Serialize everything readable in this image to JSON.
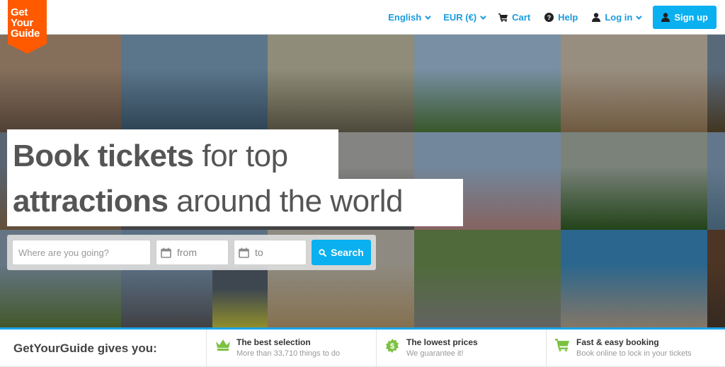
{
  "brand": {
    "logo_lines": [
      "Get",
      "Your",
      "Guide"
    ],
    "logo_color": "#ff5a00",
    "accent_color": "#0ab0f0",
    "link_color": "#1a9ce0",
    "benefit_icon_color": "#7cc242"
  },
  "nav": {
    "language": "English",
    "currency": "EUR (€)",
    "cart": "Cart",
    "help": "Help",
    "login": "Log in",
    "signup": "Sign up"
  },
  "hero": {
    "headline_line1_bold": "Book tickets",
    "headline_line1_rest": " for top",
    "headline_line2_bold": "attractions",
    "headline_line2_rest": " around the world",
    "photos": [
      {
        "name": "mosque-arcade",
        "colors": [
          "#b99a7e",
          "#6f5a4b"
        ]
      },
      {
        "name": "dubai-speedboat",
        "colors": [
          "#7ea2c0",
          "#3e5e74"
        ]
      },
      {
        "name": "taj-mahal-tourists",
        "colors": [
          "#c6c3a8",
          "#6b6652"
        ]
      },
      {
        "name": "berlin-segway",
        "colors": [
          "#a7c7e4",
          "#4f7a3a"
        ]
      },
      {
        "name": "giza-pyramids-camels",
        "colors": [
          "#d3c5b1",
          "#9b7d5a"
        ]
      },
      {
        "name": "city-skyline-edge",
        "colors": [
          "#7b93aa",
          "#5c4a2e"
        ]
      },
      {
        "name": "tower-building",
        "colors": [
          "#7a8b9a",
          "#8a6e52"
        ]
      },
      {
        "name": "tourists-photo",
        "colors": [
          "#b8b8b5",
          "#5b5a5e"
        ]
      },
      {
        "name": "sagrada-familia",
        "colors": [
          "#9ebbd8",
          "#b98a86"
        ]
      },
      {
        "name": "bungee-jungle",
        "colors": [
          "#a9b5aa",
          "#2f5e23"
        ]
      },
      {
        "name": "lake-yellow-jacket",
        "colors": [
          "#8aa6c2",
          "#5a7f98"
        ]
      },
      {
        "name": "stonehenge-visitors",
        "colors": [
          "#8da3b6",
          "#5d7b3b"
        ]
      },
      {
        "name": "westminster-bridge",
        "colors": [
          "#7f9cb7",
          "#5a5c60"
        ]
      },
      {
        "name": "bus-photographer",
        "colors": [
          "#56636f",
          "#c7c43e"
        ]
      },
      {
        "name": "sphinx-woman",
        "colors": [
          "#c6c0b3",
          "#b99c6f"
        ]
      },
      {
        "name": "great-wall",
        "colors": [
          "#6f9452",
          "#8a8a88"
        ]
      },
      {
        "name": "yellowstone-pool",
        "colors": [
          "#3b8ec4",
          "#b7a58f"
        ]
      },
      {
        "name": "market-shelves",
        "colors": [
          "#6b4a33",
          "#4a3a2e"
        ]
      }
    ]
  },
  "search": {
    "where_placeholder": "Where are you going?",
    "from_placeholder": "from",
    "to_placeholder": "to",
    "button_label": "Search"
  },
  "benefits": {
    "title": "GetYourGuide gives you:",
    "items": [
      {
        "icon": "crown-icon",
        "title": "The best selection",
        "subtitle": "More than 33,710 things to do"
      },
      {
        "icon": "dollar-badge-icon",
        "title": "The lowest prices",
        "subtitle": "We guarantee it!"
      },
      {
        "icon": "cart-icon",
        "title": "Fast & easy booking",
        "subtitle": "Book online to lock in your tickets"
      }
    ]
  }
}
